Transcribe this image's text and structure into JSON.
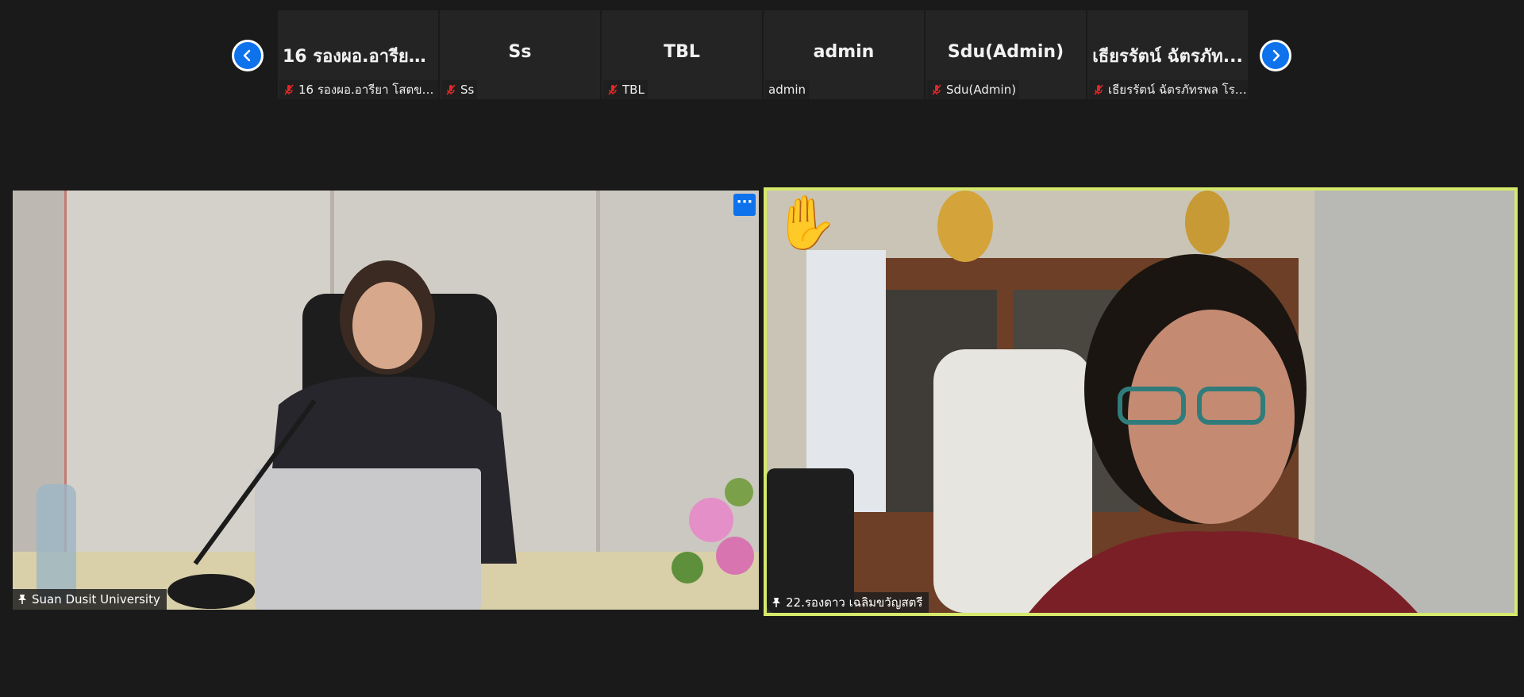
{
  "gallery": {
    "prev_icon": "chevron-left-icon",
    "next_icon": "chevron-right-icon",
    "participants": [
      {
        "title": "16 รองผอ.อารียา...",
        "label": "16 รองผอ.อารียา โสตขอน...",
        "muted": true
      },
      {
        "title": "Ss",
        "label": "Ss",
        "muted": true
      },
      {
        "title": "TBL",
        "label": "TBL",
        "muted": true
      },
      {
        "title": "admin",
        "label": "admin",
        "muted": false
      },
      {
        "title": "Sdu(Admin)",
        "label": "Sdu(Admin)",
        "muted": true
      },
      {
        "title": "เธียรรัตน์ ฉัตรภัท...",
        "label": "เธียรรัตน์ ฉัตรภัทรพล โรงเ...",
        "muted": true
      }
    ]
  },
  "main": {
    "left_tile": {
      "name": "Suan Dusit University",
      "more_label": "···"
    },
    "right_tile": {
      "name": "22.รองดาว เฉลิมขวัญสตรี",
      "reaction": "✋",
      "active_speaker_color": "#d7e96b"
    }
  },
  "colors": {
    "accent": "#0e72ed",
    "background": "#1a1a1a",
    "tile": "#242424"
  }
}
